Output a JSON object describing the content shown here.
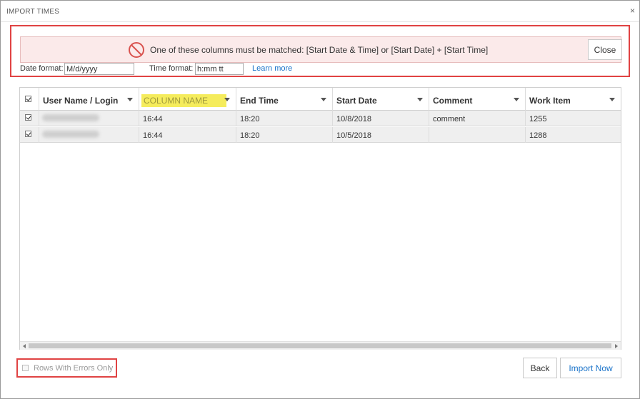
{
  "dialog": {
    "title": "IMPORT TIMES",
    "close_glyph": "×"
  },
  "error": {
    "icon": "prohibited-icon",
    "message": "One of these columns must be matched: [Start Date & Time] or [Start Date] + [Start Time]",
    "close_label": "Close",
    "color": "#e04343"
  },
  "formats": {
    "date_label": "Date format:",
    "date_value": "M/d/yyyy",
    "time_label": "Time format:",
    "time_value": "h:mm tt",
    "learn_more": "Learn more"
  },
  "grid": {
    "columns": [
      {
        "label": "User Name / Login"
      },
      {
        "label": "COLUMN NAME",
        "highlight": "#f5ec5c"
      },
      {
        "label": "End Time"
      },
      {
        "label": "Start Date"
      },
      {
        "label": "Comment"
      },
      {
        "label": "Work Item"
      }
    ],
    "rows": [
      {
        "checked": true,
        "cells": [
          "",
          "16:44",
          "18:20",
          "10/8/2018",
          "comment",
          "1255"
        ]
      },
      {
        "checked": true,
        "cells": [
          "",
          "16:44",
          "18:20",
          "10/5/2018",
          "",
          "1288"
        ]
      }
    ]
  },
  "footer": {
    "errors_only_label": "Rows With Errors Only",
    "back_label": "Back",
    "import_label": "Import Now",
    "link_color": "#1a73c9"
  }
}
